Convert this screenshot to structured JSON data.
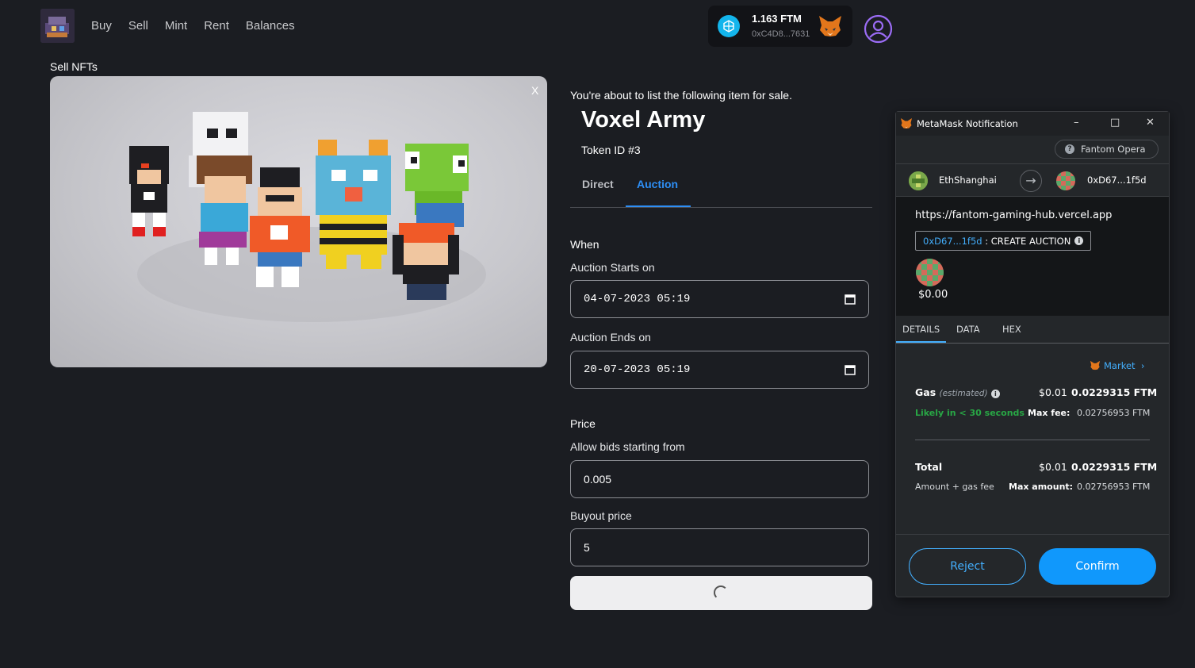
{
  "nav": {
    "items": [
      "Buy",
      "Sell",
      "Mint",
      "Rent",
      "Balances"
    ]
  },
  "wallet": {
    "balance": "1.163 FTM",
    "address": "0xC4D8...7631"
  },
  "page": {
    "title": "Sell NFTs",
    "close_label": "X"
  },
  "listing": {
    "intro": "You're about to list the following item for sale.",
    "name": "Voxel Army",
    "token_id": "Token ID #3",
    "tabs": [
      "Direct",
      "Auction"
    ],
    "active_tab": "Auction",
    "when_heading": "When",
    "starts_label": "Auction Starts on",
    "starts_value": "04-07-2023 05:19",
    "ends_label": "Auction Ends on",
    "ends_value": "20-07-2023 05:19",
    "price_heading": "Price",
    "bids_label": "Allow bids starting from",
    "bids_value": "0.005",
    "buyout_label": "Buyout price",
    "buyout_value": "5"
  },
  "metamask": {
    "window_title": "MetaMask Notification",
    "network": "Fantom Opera",
    "from_account": "EthShanghai",
    "to_account": "0xD67...1f5d",
    "origin": "https://fantom-gaming-hub.vercel.app",
    "method_contract": "0xD67...1f5d",
    "method_sep": ":",
    "method_name": "CREATE AUCTION",
    "amount": "$0.00",
    "tabs": [
      "DETAILS",
      "DATA",
      "HEX"
    ],
    "market_label": "Market",
    "gas": {
      "label": "Gas",
      "estimated": "(estimated)",
      "fiat": "$0.01",
      "value": "0.0229315 FTM",
      "likely": "Likely in < 30 seconds",
      "max_fee_label": "Max fee:",
      "max_fee_value": "0.02756953 FTM"
    },
    "total": {
      "label": "Total",
      "fiat": "$0.01",
      "value": "0.0229315 FTM",
      "sub": "Amount + gas fee",
      "max_amount_label": "Max amount:",
      "max_amount_value": "0.02756953 FTM"
    },
    "reject_label": "Reject",
    "confirm_label": "Confirm"
  },
  "colors": {
    "background": "#1b1d22",
    "accent_blue": "#2d8ef5",
    "metamask_blue": "#1098fc",
    "likely_green": "#28a745"
  },
  "icons": [
    "app-logo",
    "fantom-icon",
    "metamask-fox-icon",
    "user-icon",
    "calendar-icon",
    "spinner-icon",
    "minimize-icon",
    "maximize-icon",
    "close-icon",
    "question-icon",
    "arrow-right-icon",
    "info-icon",
    "chevron-right-icon"
  ]
}
